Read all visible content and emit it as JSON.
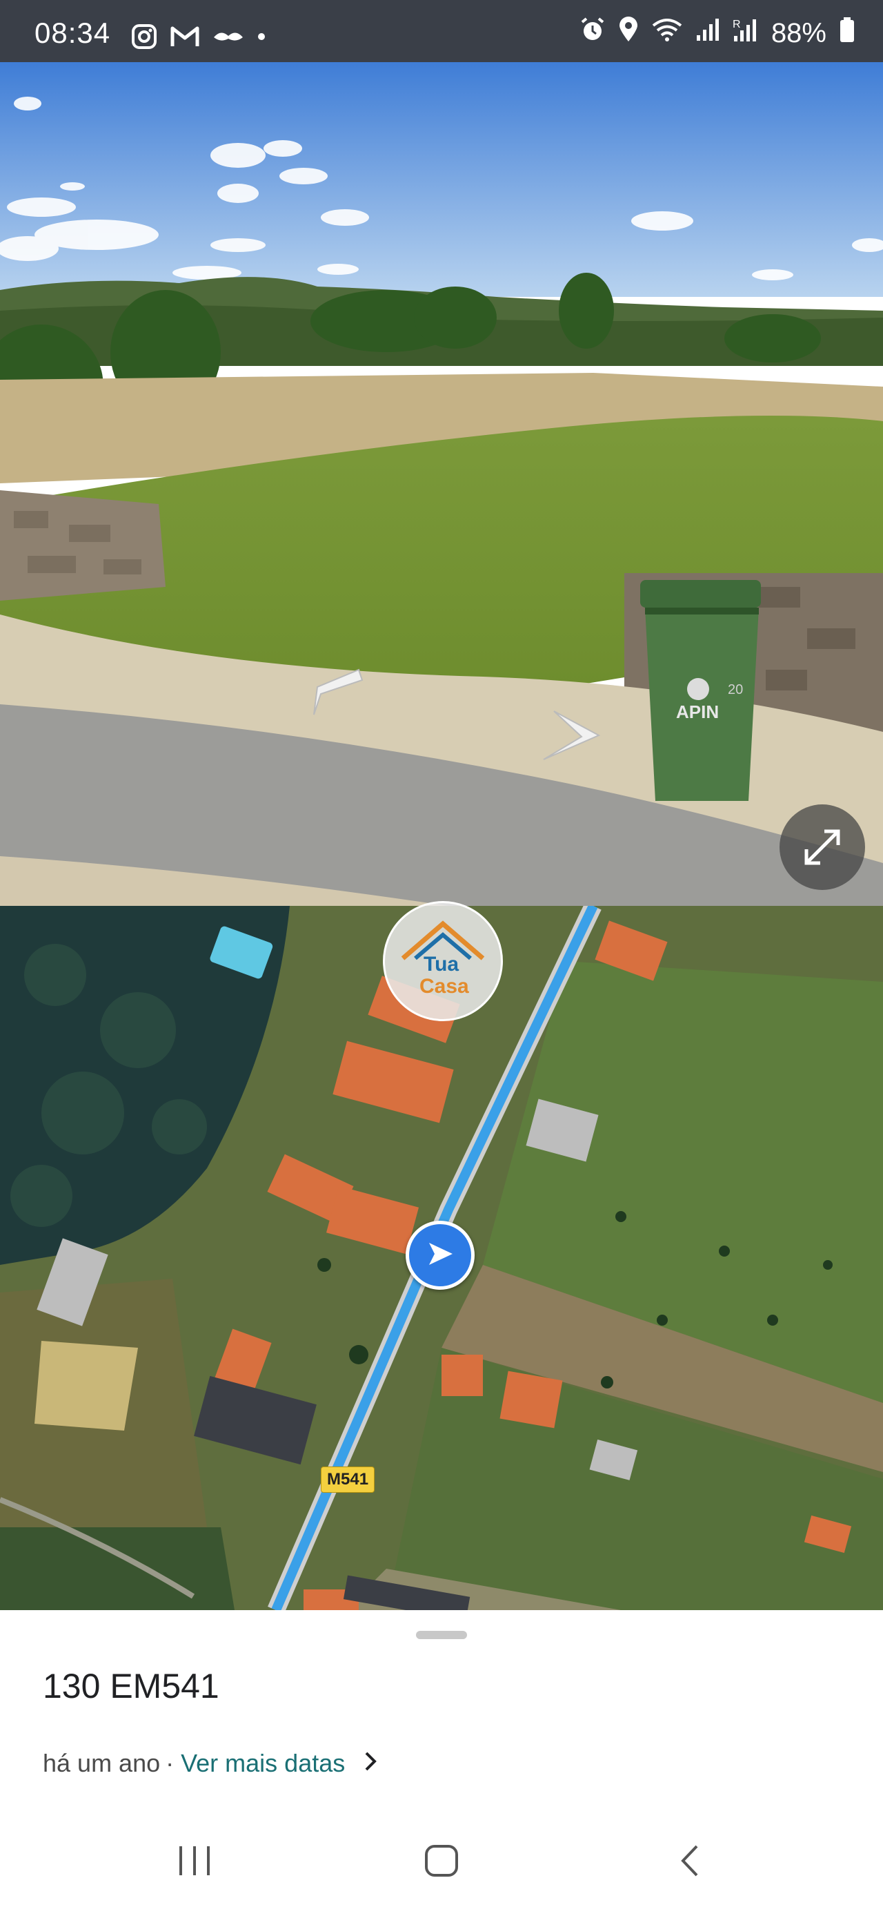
{
  "status_bar": {
    "time": "08:34",
    "left_icons": [
      "instagram-icon",
      "gmail-icon",
      "mustache-icon",
      "dot-icon"
    ],
    "right_icons": [
      "alarm-icon",
      "location-icon",
      "wifi-icon",
      "signal-icon",
      "signal-r-icon",
      "battery-icon"
    ],
    "battery": "88%"
  },
  "street_view": {
    "bin_brand": "APIN",
    "bin_number": "20",
    "expand_icon": "expand-icon",
    "arrows": [
      "nav-arrow-left",
      "nav-arrow-right"
    ]
  },
  "map": {
    "road_label": "M541",
    "logo_line1": "Tua",
    "logo_line2": "Casa",
    "marker_icon": "navigation-arrow-icon",
    "road_color": "#3aa0e8"
  },
  "sheet": {
    "title": "130 EM541",
    "date_text": "há um ano",
    "separator": "·",
    "more_dates_link": "Ver mais datas",
    "link_color": "#1a6f74"
  },
  "nav_bar": {
    "icons": [
      "recents-icon",
      "home-icon",
      "back-icon"
    ]
  }
}
